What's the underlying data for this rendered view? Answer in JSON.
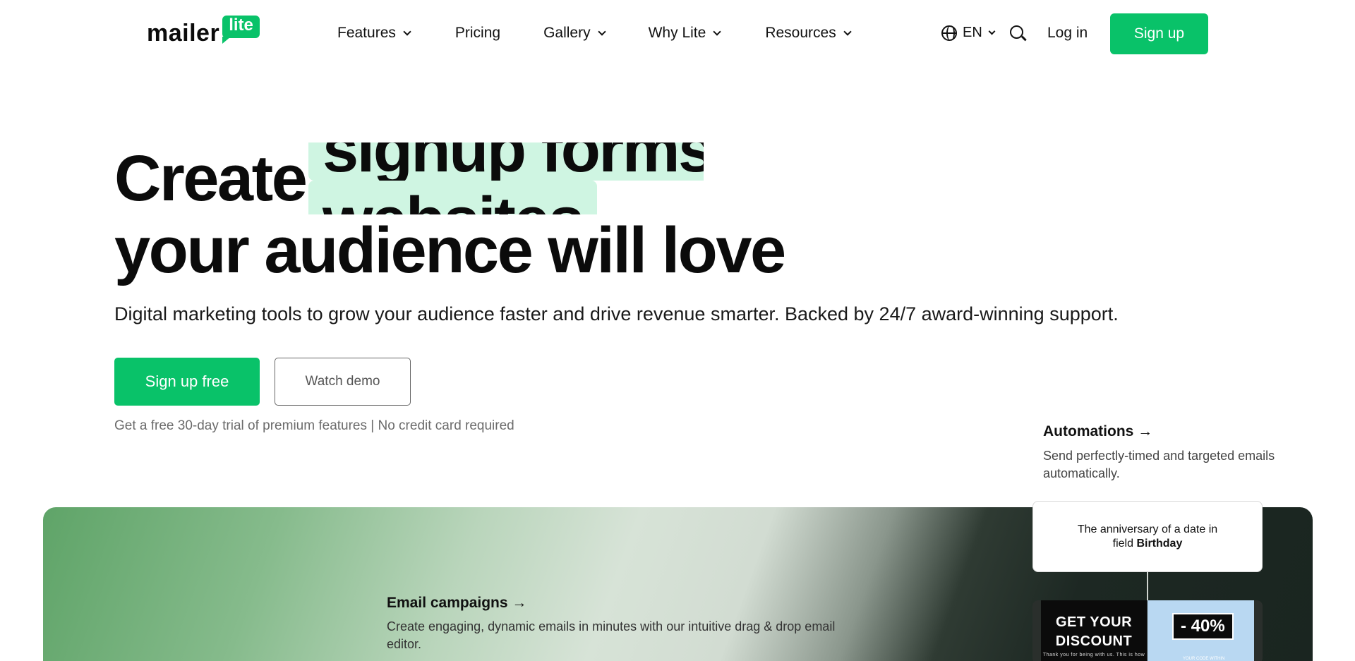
{
  "header": {
    "logo_word": "mailer",
    "logo_badge": "lite",
    "nav": [
      {
        "label": "Features",
        "has_dropdown": true
      },
      {
        "label": "Pricing",
        "has_dropdown": false
      },
      {
        "label": "Gallery",
        "has_dropdown": true
      },
      {
        "label": "Why Lite",
        "has_dropdown": true
      },
      {
        "label": "Resources",
        "has_dropdown": true
      }
    ],
    "language": "EN",
    "login_label": "Log in",
    "signup_label": "Sign up"
  },
  "hero": {
    "create_word": "Create",
    "rotating_words": [
      "signup forms",
      "websites"
    ],
    "line2": "your audience will love",
    "subtitle": "Digital marketing tools to grow your audience faster and drive revenue smarter. Backed by 24/7 award-winning support.",
    "cta_primary": "Sign up free",
    "cta_secondary": "Watch demo",
    "trial_note": "Get a free 30-day trial of premium features | No credit card required"
  },
  "features": {
    "automations": {
      "title": "Automations →",
      "desc": "Send perfectly-timed and targeted emails automatically."
    },
    "email_campaigns": {
      "title": "Email campaigns →",
      "desc": "Create engaging, dynamic emails in minutes with our intuitive drag & drop email editor."
    }
  },
  "automation_card": {
    "line1": "The anniversary of a date in",
    "line2_prefix": "field",
    "line2_bold": "Birthday"
  },
  "promo": {
    "headline_line1": "GET YOUR",
    "headline_line2": "DISCOUNT",
    "small_text": "Thank you for being with us. This is how",
    "badge": "- 40%",
    "right_small": "YOUR CODE WITHIN"
  },
  "colors": {
    "brand_green": "#09c269",
    "highlight_mint": "#cff5e2",
    "text_dark": "#0b0b0b",
    "text_muted": "#6b6b6b"
  },
  "icons": {
    "globe": "globe-icon",
    "search": "search-icon",
    "chevron": "chevron-down-icon"
  }
}
